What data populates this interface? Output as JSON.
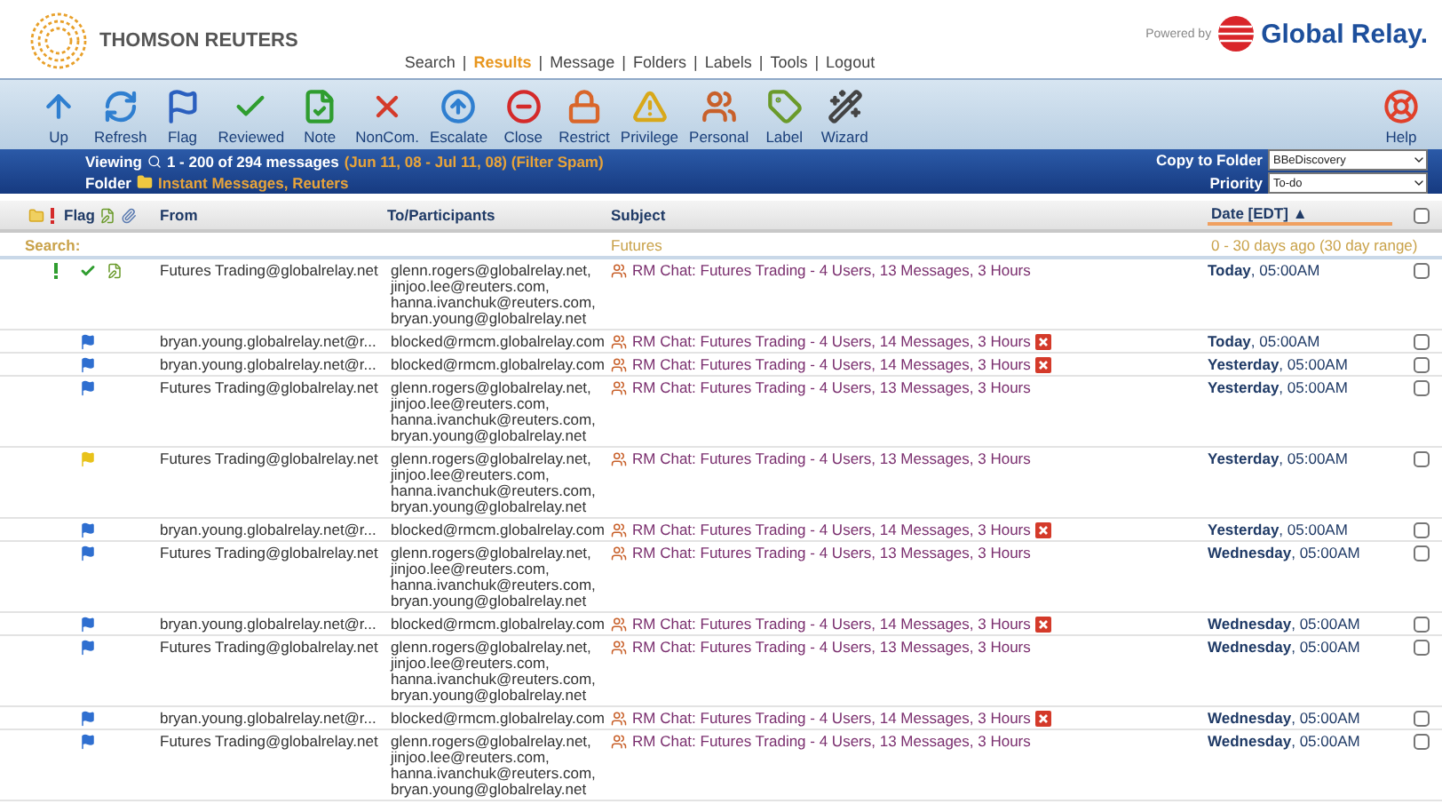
{
  "brand": {
    "name": "THOMSON REUTERS",
    "powered_by": "Powered by",
    "partner": "Global Relay."
  },
  "nav": {
    "separator": "|",
    "items": [
      {
        "label": "Search",
        "selected": false
      },
      {
        "label": "Results",
        "selected": true
      },
      {
        "label": "Message",
        "selected": false
      },
      {
        "label": "Folders",
        "selected": false
      },
      {
        "label": "Labels",
        "selected": false
      },
      {
        "label": "Tools",
        "selected": false
      },
      {
        "label": "Logout",
        "selected": false
      }
    ]
  },
  "toolbar": [
    {
      "kind": "up",
      "label": "Up"
    },
    {
      "kind": "refresh",
      "label": "Refresh"
    },
    {
      "kind": "flag",
      "label": "Flag"
    },
    {
      "kind": "reviewed",
      "label": "Reviewed"
    },
    {
      "kind": "note",
      "label": "Note"
    },
    {
      "kind": "noncom",
      "label": "NonCom."
    },
    {
      "kind": "escalate",
      "label": "Escalate"
    },
    {
      "kind": "close",
      "label": "Close"
    },
    {
      "kind": "restrict",
      "label": "Restrict"
    },
    {
      "kind": "privilege",
      "label": "Privilege"
    },
    {
      "kind": "personal",
      "label": "Personal"
    },
    {
      "kind": "label",
      "label": "Label"
    },
    {
      "kind": "wizard",
      "label": "Wizard"
    }
  ],
  "help": {
    "label": "Help"
  },
  "info_bar": {
    "viewing_label": "Viewing",
    "viewing": "1 - 200 of 294 messages",
    "range": "(Jun 11, 08 - Jul 11, 08) (Filter Spam)",
    "folder_label": "Folder",
    "folder": "Instant Messages, Reuters",
    "copy_label": "Copy to Folder",
    "copy_value": "BBeDiscovery",
    "priority_label": "Priority",
    "priority_value": "To-do"
  },
  "columns": {
    "flag": "Flag",
    "from": "From",
    "to": "To/Participants",
    "subject": "Subject",
    "date": "Date [EDT]",
    "sort": "▲",
    "select_all_checked": false
  },
  "search": {
    "label": "Search:",
    "subject": "Futures",
    "date": "0 - 30 days ago (30 day range)"
  },
  "rows": [
    {
      "priority": true,
      "reviewed": true,
      "note": true,
      "from": "Futures Trading@globalrelay.net",
      "to": [
        "glenn.rogers@globalrelay.net,",
        "jinjoo.lee@reuters.com,",
        "hanna.ivanchuk@reuters.com,",
        "bryan.young@globalrelay.net"
      ],
      "subject": "RM Chat: Futures Trading - 4 Users, 13 Messages, 3 Hours",
      "blocked": false,
      "date": "**Today**, 05:00AM",
      "checked": false
    },
    {
      "priority": false,
      "reviewed": false,
      "note": false,
      "flag": {
        "color": "#2f6fd0"
      },
      "from": "bryan.young.globalrelay.net@r...",
      "to": [
        "blocked@rmcm.globalrelay.com"
      ],
      "subject": "RM Chat: Futures Trading - 4 Users, 14 Messages, 3 Hours",
      "blocked": true,
      "date": "**Today**, 05:00AM",
      "checked": false
    },
    {
      "priority": false,
      "reviewed": false,
      "note": false,
      "flag": {
        "color": "#2f6fd0"
      },
      "from": "bryan.young.globalrelay.net@r...",
      "to": [
        "blocked@rmcm.globalrelay.com"
      ],
      "subject": "RM Chat: Futures Trading - 4 Users, 14 Messages, 3 Hours",
      "blocked": true,
      "date": "**Yesterday**, 05:00AM",
      "checked": false
    },
    {
      "priority": false,
      "reviewed": false,
      "note": false,
      "flag": {
        "color": "#2f6fd0"
      },
      "from": "Futures Trading@globalrelay.net",
      "to": [
        "glenn.rogers@globalrelay.net,",
        "jinjoo.lee@reuters.com,",
        "hanna.ivanchuk@reuters.com,",
        "bryan.young@globalrelay.net"
      ],
      "subject": "RM Chat: Futures Trading - 4 Users, 13 Messages, 3 Hours",
      "blocked": false,
      "date": "**Yesterday**, 05:00AM",
      "checked": false
    },
    {
      "priority": false,
      "reviewed": false,
      "note": false,
      "flag": {
        "color": "#e8c21a"
      },
      "from": "Futures Trading@globalrelay.net",
      "to": [
        "glenn.rogers@globalrelay.net,",
        "jinjoo.lee@reuters.com,",
        "hanna.ivanchuk@reuters.com,",
        "bryan.young@globalrelay.net"
      ],
      "subject": "RM Chat: Futures Trading - 4 Users, 13 Messages, 3 Hours",
      "blocked": false,
      "date": "**Yesterday**, 05:00AM",
      "checked": false
    },
    {
      "priority": false,
      "reviewed": false,
      "note": false,
      "flag": {
        "color": "#2f6fd0"
      },
      "from": "bryan.young.globalrelay.net@r...",
      "to": [
        "blocked@rmcm.globalrelay.com"
      ],
      "subject": "RM Chat: Futures Trading - 4 Users, 14 Messages, 3 Hours",
      "blocked": true,
      "date": "**Yesterday**, 05:00AM",
      "checked": false
    },
    {
      "priority": false,
      "reviewed": false,
      "note": false,
      "flag": {
        "color": "#2f6fd0"
      },
      "from": "Futures Trading@globalrelay.net",
      "to": [
        "glenn.rogers@globalrelay.net,",
        "jinjoo.lee@reuters.com,",
        "hanna.ivanchuk@reuters.com,",
        "bryan.young@globalrelay.net"
      ],
      "subject": "RM Chat: Futures Trading - 4 Users, 13 Messages, 3 Hours",
      "blocked": false,
      "date": "**Wednesday**, 05:00AM",
      "checked": false
    },
    {
      "priority": false,
      "reviewed": false,
      "note": false,
      "flag": {
        "color": "#2f6fd0"
      },
      "from": "bryan.young.globalrelay.net@r...",
      "to": [
        "blocked@rmcm.globalrelay.com"
      ],
      "subject": "RM Chat: Futures Trading - 4 Users, 14 Messages, 3 Hours",
      "blocked": true,
      "date": "**Wednesday**, 05:00AM",
      "checked": false
    },
    {
      "priority": false,
      "reviewed": false,
      "note": false,
      "flag": {
        "color": "#2f6fd0"
      },
      "from": "Futures Trading@globalrelay.net",
      "to": [
        "glenn.rogers@globalrelay.net,",
        "jinjoo.lee@reuters.com,",
        "hanna.ivanchuk@reuters.com,",
        "bryan.young@globalrelay.net"
      ],
      "subject": "RM Chat: Futures Trading - 4 Users, 13 Messages, 3 Hours",
      "blocked": false,
      "date": "**Wednesday**, 05:00AM",
      "checked": false
    },
    {
      "priority": false,
      "reviewed": false,
      "note": false,
      "flag": {
        "color": "#2f6fd0"
      },
      "from": "bryan.young.globalrelay.net@r...",
      "to": [
        "blocked@rmcm.globalrelay.com"
      ],
      "subject": "RM Chat: Futures Trading - 4 Users, 14 Messages, 3 Hours",
      "blocked": true,
      "date": "**Wednesday**, 05:00AM",
      "checked": false
    },
    {
      "priority": false,
      "reviewed": false,
      "note": false,
      "flag": {
        "color": "#2f6fd0"
      },
      "from": "Futures Trading@globalrelay.net",
      "to": [
        "glenn.rogers@globalrelay.net,",
        "jinjoo.lee@reuters.com,",
        "hanna.ivanchuk@reuters.com,",
        "bryan.young@globalrelay.net"
      ],
      "subject": "RM Chat: Futures Trading - 4 Users, 13 Messages, 3 Hours",
      "blocked": false,
      "date": "**Wednesday**, 05:00AM",
      "checked": false
    }
  ]
}
